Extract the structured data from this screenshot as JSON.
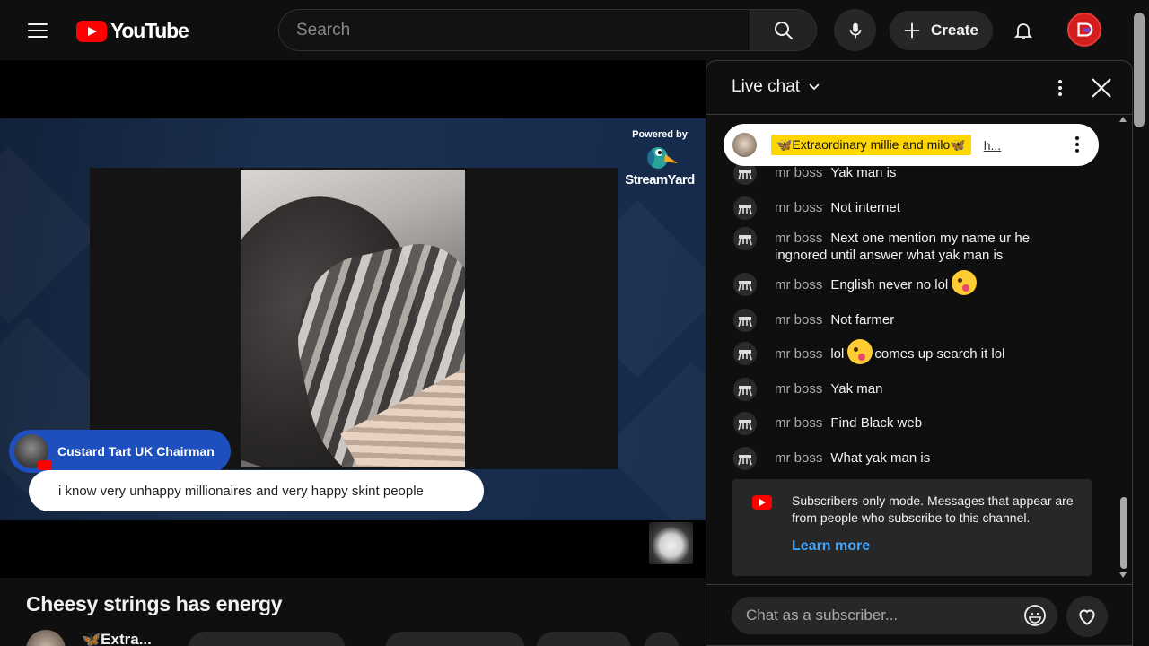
{
  "masthead": {
    "logo_text": "YouTube",
    "search_placeholder": "Search",
    "create_label": "Create"
  },
  "player": {
    "powered_by": "Powered by",
    "streamyard": "StreamYard",
    "overlay_user": "Custard Tart UK Chairman",
    "overlay_message": "i know very unhappy millionaires and very happy skint people"
  },
  "video": {
    "title": "Cheesy strings has energy",
    "channel_short": "🦋Extra..."
  },
  "chat": {
    "title": "Live chat",
    "pinned": {
      "name": "🦋Extraordinary millie and milo🦋",
      "text": "h..."
    },
    "messages": [
      {
        "author": "mr boss",
        "text": "Yak man is"
      },
      {
        "author": "mr boss",
        "text": "Not internet"
      },
      {
        "author": "mr boss",
        "text": "Next one mention my name ur he ingnored until answer what yak man is"
      },
      {
        "author": "mr boss",
        "text": "English never no lol",
        "emoji_after": "tongue-emoji"
      },
      {
        "author": "mr boss",
        "text": "Not farmer"
      },
      {
        "author": "mr boss",
        "text_before": "lol",
        "emoji_mid": "tongue-emoji",
        "text_after": "comes up search it lol"
      },
      {
        "author": "mr boss",
        "text": "Yak man"
      },
      {
        "author": "mr boss",
        "text": "Find Black web"
      },
      {
        "author": "mr boss",
        "text": "What yak man is"
      }
    ],
    "notice": {
      "text": "Subscribers-only mode. Messages that appear are from people who subscribe to this channel.",
      "link": "Learn more"
    },
    "input_placeholder": "Chat as a subscriber..."
  },
  "colors": {
    "brand_red": "#ff0000",
    "link_blue": "#3ea6ff",
    "overlay_blue": "#1e4fbf",
    "pinned_highlight": "#ffd600"
  }
}
